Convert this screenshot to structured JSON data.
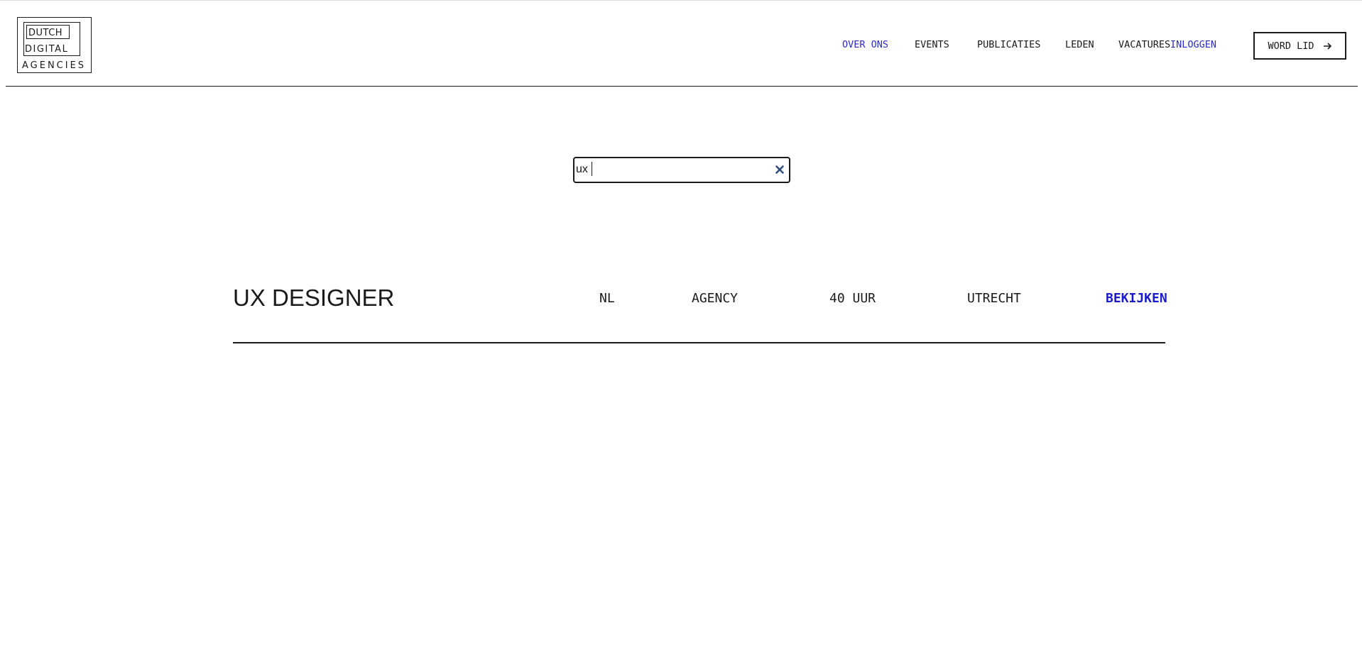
{
  "logo": {
    "line1": "DUTCH",
    "line2": "DIGITAL",
    "line3": "AGENCIES"
  },
  "nav": {
    "items": [
      {
        "label": "OVER ONS",
        "active": true
      },
      {
        "label": "EVENTS"
      },
      {
        "label": "PUBLICATIES"
      },
      {
        "label": "LEDEN"
      },
      {
        "label": "VACATURES"
      },
      {
        "label": "INLOGGEN"
      }
    ],
    "cta_label": "WORD LID",
    "cta_icon": "arrow-right-icon"
  },
  "search": {
    "value": "ux",
    "clear_icon": "close-icon"
  },
  "results": [
    {
      "title": "UX DESIGNER",
      "language": "NL",
      "type": "AGENCY",
      "hours": "40 UUR",
      "location": "UTRECHT",
      "link_label": "BEKIJKEN"
    }
  ],
  "colors": {
    "accent": "#2b2bcc",
    "link": "#1a1acc",
    "text": "#1a1a1a"
  }
}
